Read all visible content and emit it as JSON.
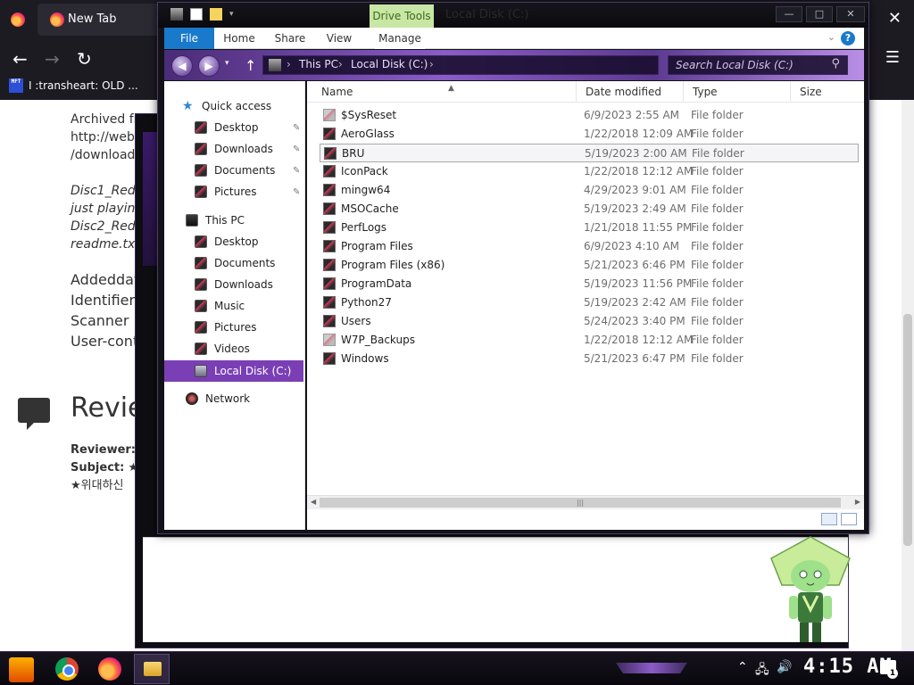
{
  "browser": {
    "tab_title": "New Tab",
    "bookmark_icon_text": "MFT",
    "bookmark_label": "I :transheart: OLD ...",
    "close_glyph": "✕",
    "menu_glyph": "☰",
    "back_glyph": "←",
    "forward_glyph": "→",
    "reload_glyph": "↻"
  },
  "page": {
    "archived_lines": [
      "Archived fro",
      "http://web.a",
      "/downloads"
    ],
    "italic_lines": [
      "Disc1_Red",
      "just playing",
      "Disc2_Red",
      "readme.txt -"
    ],
    "meta_lines": [
      "Addeddate",
      "Identifier",
      "Scanner",
      "User-contr"
    ],
    "review_title": "Revie",
    "reviewer_label": "Reviewer:",
    "subject_label": "Subject:",
    "subject_star": "★",
    "review_text": "★위대하신"
  },
  "explorer": {
    "window_title": "Local Disk (C:)",
    "context_tab": "Drive Tools",
    "controls": {
      "minimize": "—",
      "maximize": "□",
      "close": "✕"
    },
    "ribbon_tabs": [
      "File",
      "Home",
      "Share",
      "View",
      "Manage"
    ],
    "help_glyph": "?",
    "breadcrumbs": [
      "This PC",
      "Local Disk (C:)"
    ],
    "search_placeholder": "Search Local Disk (C:)",
    "nav": {
      "quick_access": "Quick access",
      "quick_items": [
        "Desktop",
        "Downloads",
        "Documents",
        "Pictures"
      ],
      "this_pc": "This PC",
      "pc_items": [
        "Desktop",
        "Documents",
        "Downloads",
        "Music",
        "Pictures",
        "Videos"
      ],
      "selected_drive": "Local Disk (C:)",
      "network": "Network"
    },
    "columns": {
      "name": "Name",
      "date": "Date modified",
      "type": "Type",
      "size": "Size"
    },
    "files": [
      {
        "name": "$SysReset",
        "date": "6/9/2023 2:55 AM",
        "type": "File folder"
      },
      {
        "name": "AeroGlass",
        "date": "1/22/2018 12:09 AM",
        "type": "File folder"
      },
      {
        "name": "BRU",
        "date": "5/19/2023 2:00 AM",
        "type": "File folder"
      },
      {
        "name": "IconPack",
        "date": "1/22/2018 12:12 AM",
        "type": "File folder"
      },
      {
        "name": "mingw64",
        "date": "4/29/2023 9:01 AM",
        "type": "File folder"
      },
      {
        "name": "MSOCache",
        "date": "5/19/2023 2:49 AM",
        "type": "File folder"
      },
      {
        "name": "PerfLogs",
        "date": "1/21/2018 11:55 PM",
        "type": "File folder"
      },
      {
        "name": "Program Files",
        "date": "6/9/2023 4:10 AM",
        "type": "File folder"
      },
      {
        "name": "Program Files (x86)",
        "date": "5/21/2023 6:46 PM",
        "type": "File folder"
      },
      {
        "name": "ProgramData",
        "date": "5/19/2023 11:56 PM",
        "type": "File folder"
      },
      {
        "name": "Python27",
        "date": "5/19/2023 2:42 AM",
        "type": "File folder"
      },
      {
        "name": "Users",
        "date": "5/24/2023 3:40 PM",
        "type": "File folder"
      },
      {
        "name": "W7P_Backups",
        "date": "1/22/2018 12:12 AM",
        "type": "File folder"
      },
      {
        "name": "Windows",
        "date": "5/21/2023 6:47 PM",
        "type": "File folder"
      }
    ],
    "hovered_file": "BRU"
  },
  "taskbar": {
    "clock": "4:15 AM",
    "notification_count": "1"
  },
  "colors": {
    "accent_purple": "#7b3fb5",
    "ribbon_blue": "#1979ca",
    "drive_tools_green": "#c8e6a4"
  }
}
